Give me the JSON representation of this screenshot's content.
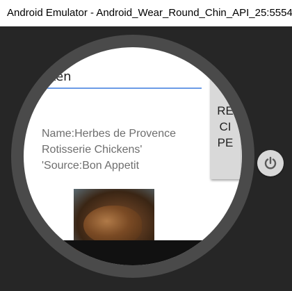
{
  "window": {
    "title": "Android Emulator - Android_Wear_Round_Chin_API_25:5554"
  },
  "watch": {
    "search": {
      "value": "hicken"
    },
    "recipe_button": {
      "label": "RE\nCI\nPE"
    },
    "recipe": {
      "info": "Name:Herbes de Provence\nRotisserie Chickens'\n'Source:Bon Appetit"
    },
    "image": {
      "name": "chicken-image"
    }
  },
  "emulator_controls": {
    "power_icon": "power-icon"
  },
  "colors": {
    "title_bar": "#ffffff",
    "emulator_background": "#262626",
    "bezel": "#4a4a4a",
    "screen": "#ffffff",
    "underline_accent": "#6b9be6",
    "button_background": "#d9d9d9",
    "recipe_text": "#6e6e6e"
  }
}
